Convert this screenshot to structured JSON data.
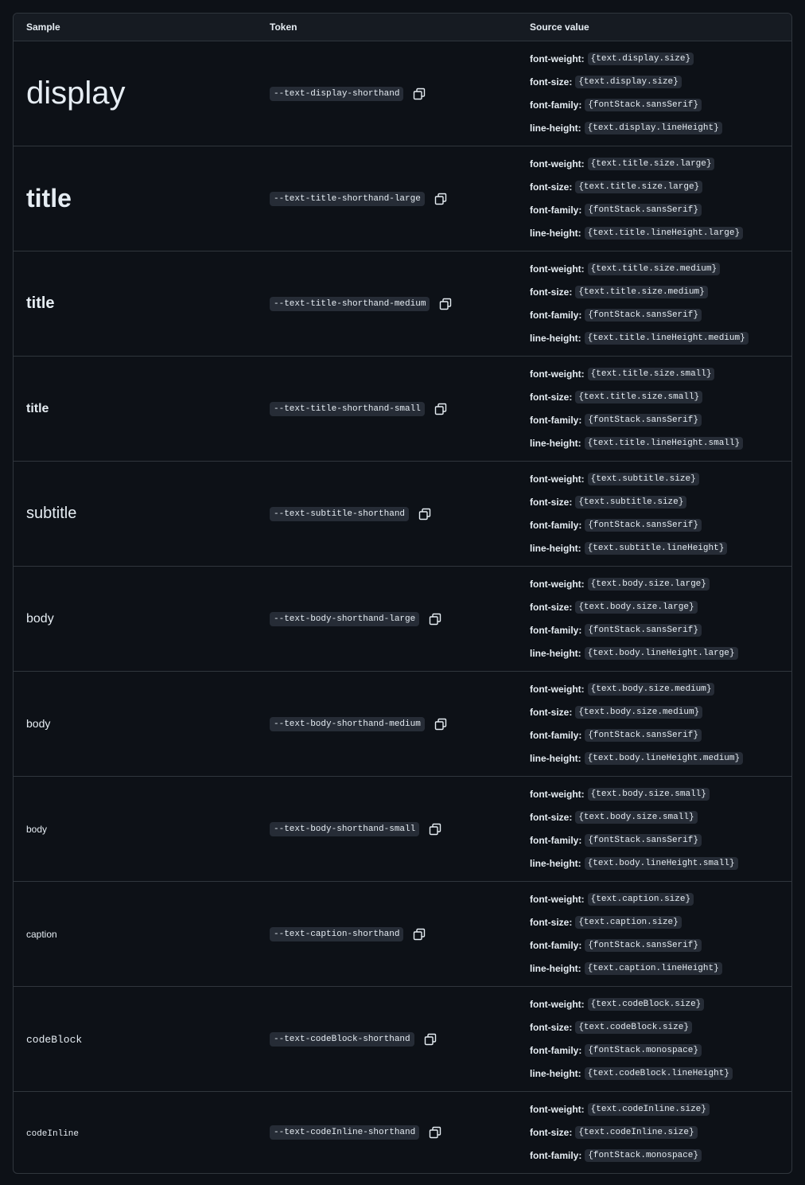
{
  "header": {
    "sample": "Sample",
    "token": "Token",
    "source": "Source value"
  },
  "labels": {
    "weight": "font-weight:",
    "size": "font-size:",
    "family": "font-family:",
    "lineheight": "line-height:"
  },
  "rows": [
    {
      "sample": "display",
      "token": "--text-display-shorthand",
      "weight": "{text.display.size}",
      "size": "{text.display.size}",
      "family": "{fontStack.sansSerif}",
      "lineheight": "{text.display.lineHeight}"
    },
    {
      "sample": "title",
      "token": "--text-title-shorthand-large",
      "weight": "{text.title.size.large}",
      "size": "{text.title.size.large}",
      "family": "{fontStack.sansSerif}",
      "lineheight": "{text.title.lineHeight.large}"
    },
    {
      "sample": "title",
      "token": "--text-title-shorthand-medium",
      "weight": "{text.title.size.medium}",
      "size": "{text.title.size.medium}",
      "family": "{fontStack.sansSerif}",
      "lineheight": "{text.title.lineHeight.medium}"
    },
    {
      "sample": "title",
      "token": "--text-title-shorthand-small",
      "weight": "{text.title.size.small}",
      "size": "{text.title.size.small}",
      "family": "{fontStack.sansSerif}",
      "lineheight": "{text.title.lineHeight.small}"
    },
    {
      "sample": "subtitle",
      "token": "--text-subtitle-shorthand",
      "weight": "{text.subtitle.size}",
      "size": "{text.subtitle.size}",
      "family": "{fontStack.sansSerif}",
      "lineheight": "{text.subtitle.lineHeight}"
    },
    {
      "sample": "body",
      "token": "--text-body-shorthand-large",
      "weight": "{text.body.size.large}",
      "size": "{text.body.size.large}",
      "family": "{fontStack.sansSerif}",
      "lineheight": "{text.body.lineHeight.large}"
    },
    {
      "sample": "body",
      "token": "--text-body-shorthand-medium",
      "weight": "{text.body.size.medium}",
      "size": "{text.body.size.medium}",
      "family": "{fontStack.sansSerif}",
      "lineheight": "{text.body.lineHeight.medium}"
    },
    {
      "sample": "body",
      "token": "--text-body-shorthand-small",
      "weight": "{text.body.size.small}",
      "size": "{text.body.size.small}",
      "family": "{fontStack.sansSerif}",
      "lineheight": "{text.body.lineHeight.small}"
    },
    {
      "sample": "caption",
      "token": "--text-caption-shorthand",
      "weight": "{text.caption.size}",
      "size": "{text.caption.size}",
      "family": "{fontStack.sansSerif}",
      "lineheight": "{text.caption.lineHeight}"
    },
    {
      "sample": "codeBlock",
      "token": "--text-codeBlock-shorthand",
      "weight": "{text.codeBlock.size}",
      "size": "{text.codeBlock.size}",
      "family": "{fontStack.monospace}",
      "lineheight": "{text.codeBlock.lineHeight}"
    },
    {
      "sample": "codeInline",
      "token": "--text-codeInline-shorthand",
      "weight": "{text.codeInline.size}",
      "size": "{text.codeInline.size}",
      "family": "{fontStack.monospace}"
    }
  ],
  "icons": {
    "copy": "copy-icon"
  }
}
